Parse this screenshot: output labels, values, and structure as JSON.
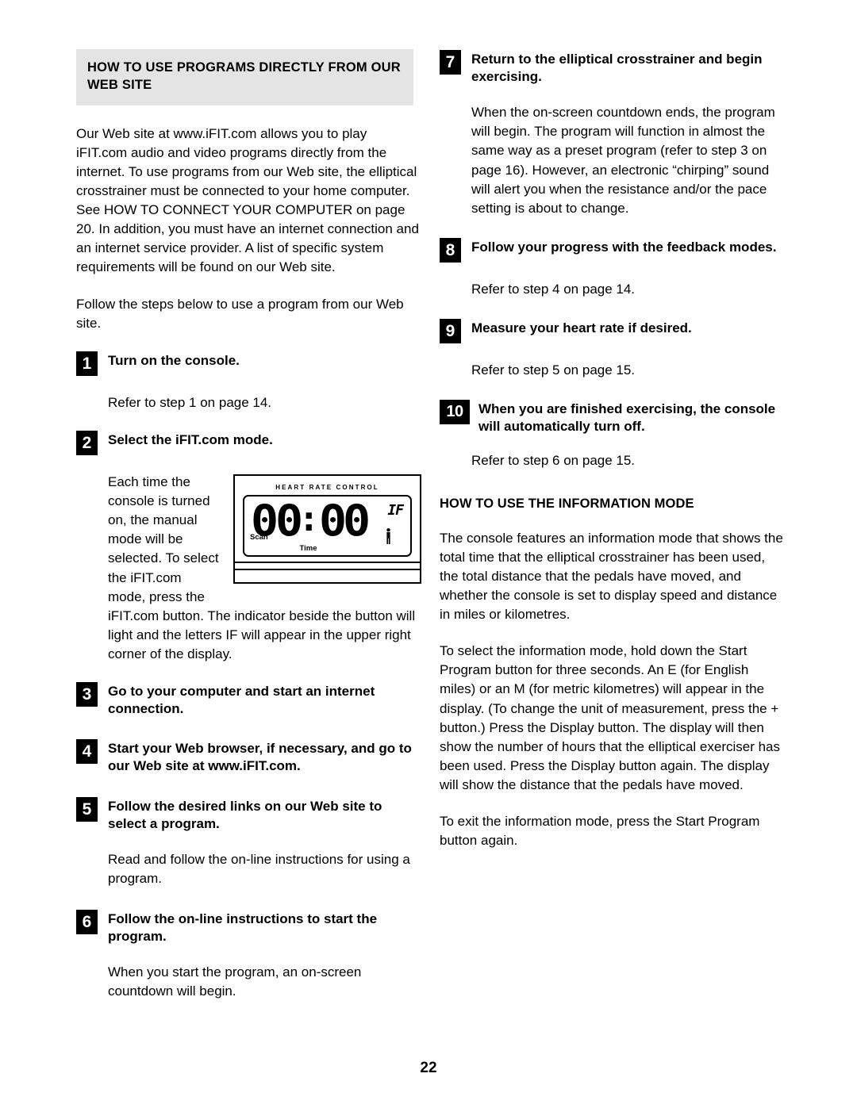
{
  "page_number": "22",
  "left_column": {
    "section_title": "HOW TO USE PROGRAMS DIRECTLY FROM OUR WEB SITE",
    "intro_paragraph": "Our Web site at www.iFIT.com allows you to play iFIT.com audio and video programs directly from the internet. To use programs from our Web site, the elliptical crosstrainer must be connected to your home computer. See HOW TO CONNECT YOUR COMPUTER on page 20. In addition, you must have an internet connection and an internet service provider. A list of specific system requirements will be found on our Web site.",
    "follow_steps_paragraph": "Follow the steps below to use a program from our Web site.",
    "steps": [
      {
        "number": "1",
        "title": "Turn on the console.",
        "body": "Refer to step 1 on page 14."
      },
      {
        "number": "2",
        "title": "Select the iFIT.com mode.",
        "body": "Each time the console is turned on, the manual mode will be selected. To select the iFIT.com mode, press the iFIT.com button. The indicator beside the button will light and the letters IF will appear in the upper right corner of the display."
      },
      {
        "number": "3",
        "title": "Go to your computer and start an internet connection.",
        "body": ""
      },
      {
        "number": "4",
        "title": "Start your Web browser, if necessary, and go to our Web site at www.iFIT.com.",
        "body": ""
      },
      {
        "number": "5",
        "title": "Follow the desired links on our Web site to select a program.",
        "body": "Read and follow the on-line instructions for using a program."
      },
      {
        "number": "6",
        "title": "Follow the on-line instructions to start the program.",
        "body": "When you start the program, an on-screen countdown will begin."
      }
    ]
  },
  "console_figure": {
    "heart_rate_label": "HEART RATE CONTROL",
    "digits": "00:00",
    "digit_1": "0",
    "digit_2": "0",
    "colon": ":",
    "digit_3": "0",
    "digit_4": "0",
    "ifit_indicator": "IF",
    "scan_label": "Scan",
    "time_label": "Time",
    "person_icon": "person-icon"
  },
  "right_column": {
    "steps": [
      {
        "number": "7",
        "title": "Return to the elliptical crosstrainer and begin exercising.",
        "body": "When the on-screen countdown ends, the program will begin. The program will function in almost the same way as a preset program (refer to step 3 on page 16). However, an electronic “chirping” sound will alert you when the resistance and/or the pace setting is about to change."
      },
      {
        "number": "8",
        "title": "Follow your progress with the feedback modes.",
        "body": "Refer to step 4 on page 14."
      },
      {
        "number": "9",
        "title": "Measure your heart rate if desired.",
        "body": "Refer to step 5 on page 15."
      },
      {
        "number": "10",
        "title": "When you are finished exercising, the console will automatically turn off.",
        "body": "Refer to step 6 on page 15."
      }
    ],
    "info_section_title": "HOW TO USE THE INFORMATION MODE",
    "info_paragraph_1": "The console features an information mode that shows the total time that the elliptical crosstrainer has been used, the total distance that the pedals have moved, and whether the console is set to display speed and distance in miles or kilometres.",
    "info_paragraph_2": "To select the information mode, hold down the Start Program button for three seconds. An E (for English miles) or an M (for metric kilometres) will appear in the display. (To change the unit of measurement, press the + button.) Press the Display button. The display will then show the number of hours that the elliptical exerciser has been used. Press the Display button again. The display will show the distance that the pedals have moved.",
    "info_paragraph_3": "To exit the information mode, press the Start Program button again."
  }
}
